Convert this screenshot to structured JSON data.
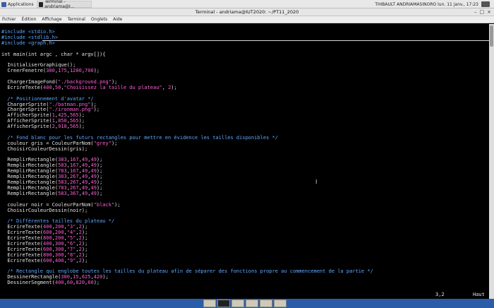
{
  "topbar": {
    "apps_label": "Applications",
    "task_label": "Terminal - andriama@I...",
    "user_clock": "THIBAULT ANDRIAMASINORO lun. 11 janv., 17:23"
  },
  "window": {
    "title": "Terminal - andriama@IUT2020: ~/PT11_2020"
  },
  "menu": {
    "items": [
      "Fichier",
      "Édition",
      "Affichage",
      "Terminal",
      "Onglets",
      "Aide"
    ]
  },
  "code_lines": [
    {
      "t": "pp",
      "v": "#include <stdio.h>"
    },
    {
      "t": "pp",
      "v": "#include <stdlib.h>"
    },
    {
      "t": "pp",
      "v": "#include <graph.h>"
    },
    {
      "t": "txt",
      "v": ""
    },
    {
      "t": "txt",
      "v": "int main(int argc , char * argv[]){"
    },
    {
      "t": "txt",
      "v": ""
    },
    {
      "t": "txt",
      "v": "  InitialiserGraphique();"
    },
    {
      "t": "txt",
      "v": "  CreerFenetre(300,175,1200,700);"
    },
    {
      "t": "txt",
      "v": ""
    },
    {
      "t": "txt",
      "v": "  ChargerImageFond(\"./background.png\");"
    },
    {
      "t": "txt",
      "v": "  EcrireTexte(400,50,\"Choisissez la taille du plateau\", 2);"
    },
    {
      "t": "txt",
      "v": ""
    },
    {
      "t": "cm",
      "v": "  /* Positionnement d'avatar */"
    },
    {
      "t": "txt",
      "v": "  ChargerSprite(\"./batman.png\");"
    },
    {
      "t": "txt",
      "v": "  ChargerSprite(\"./ironman.png\");"
    },
    {
      "t": "txt",
      "v": "  AfficherSprite(1,425,565);"
    },
    {
      "t": "txt",
      "v": "  AfficherSprite(1,850,565);"
    },
    {
      "t": "txt",
      "v": "  AfficherSprite(2,918,565);"
    },
    {
      "t": "txt",
      "v": ""
    },
    {
      "t": "cm",
      "v": "  /* Fond blanc pour les futurs rectangles pour mettre en évidence les tailles disponibles */"
    },
    {
      "t": "txt",
      "v": "  couleur gris = CouleurParNom(\"grey\");"
    },
    {
      "t": "txt",
      "v": "  ChoisirCouleurDessin(gris);"
    },
    {
      "t": "txt",
      "v": ""
    },
    {
      "t": "txt",
      "v": "  RemplirRectangle(383,167,49,49);"
    },
    {
      "t": "txt",
      "v": "  RemplirRectangle(583,167,49,49);"
    },
    {
      "t": "txt",
      "v": "  RemplirRectangle(783,167,49,49);"
    },
    {
      "t": "txt",
      "v": "  RemplirRectangle(383,267,49,49);"
    },
    {
      "t": "txt",
      "v": "  RemplirRectangle(583,267,49,49);"
    },
    {
      "t": "txt",
      "v": "  RemplirRectangle(783,267,49,49);"
    },
    {
      "t": "txt",
      "v": "  RemplirRectangle(583,367,49,49);"
    },
    {
      "t": "txt",
      "v": ""
    },
    {
      "t": "txt",
      "v": "  couleur noir = CouleurParNom(\"black\");"
    },
    {
      "t": "txt",
      "v": "  ChoisirCouleurDessin(noir);"
    },
    {
      "t": "txt",
      "v": ""
    },
    {
      "t": "cm",
      "v": "  /* Différentes tailles du plateau */"
    },
    {
      "t": "txt",
      "v": "  EcrireTexte(400,200,\"3\",2);"
    },
    {
      "t": "txt",
      "v": "  EcrireTexte(600,200,\"4\",2);"
    },
    {
      "t": "txt",
      "v": "  EcrireTexte(800,200,\"5\",2);"
    },
    {
      "t": "txt",
      "v": "  EcrireTexte(400,300,\"6\",2);"
    },
    {
      "t": "txt",
      "v": "  EcrireTexte(600,300,\"7\",2);"
    },
    {
      "t": "txt",
      "v": "  EcrireTexte(800,300,\"8\",2);"
    },
    {
      "t": "txt",
      "v": "  EcrireTexte(600,400,\"9\",2);"
    },
    {
      "t": "txt",
      "v": ""
    },
    {
      "t": "cm",
      "v": "  /* Rectangle qui englobe toutes les tailles du plateau afin de séparer des fonctions propre au commencement de la partie */"
    },
    {
      "t": "txt",
      "v": "  DessinerRectangle(300,15,625,420);"
    },
    {
      "t": "txt",
      "v": "  DessinerSegment(400,60,820,60);"
    }
  ],
  "status": {
    "position": "3,2",
    "scroll": "Haut"
  },
  "taskbar": {
    "icons": [
      "files-icon",
      "terminal-icon",
      "file-manager-icon",
      "browser-icon",
      "search-icon",
      "folder-icon"
    ]
  }
}
